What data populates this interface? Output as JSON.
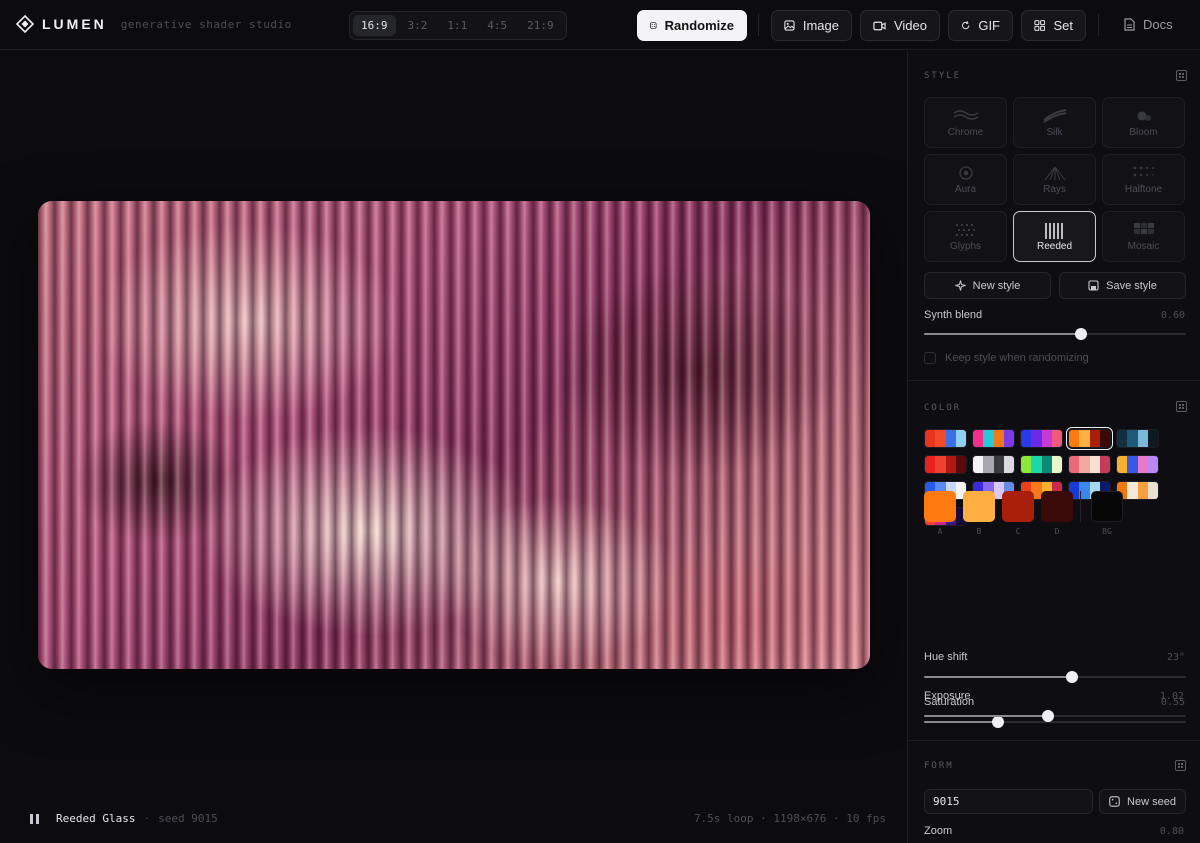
{
  "brand": {
    "name": "LUMEN",
    "subtitle": "generative shader studio"
  },
  "ratios": [
    {
      "label": "16:9",
      "active": true
    },
    {
      "label": "3:2",
      "active": false
    },
    {
      "label": "1:1",
      "active": false
    },
    {
      "label": "4:5",
      "active": false
    },
    {
      "label": "21:9",
      "active": false
    }
  ],
  "toolbar": {
    "randomize_label": "Randomize",
    "image_label": "Image",
    "video_label": "Video",
    "gif_label": "GIF",
    "set_label": "Set",
    "docs_label": "Docs"
  },
  "footer": {
    "title": "Reeded Glass",
    "seed": "seed 9015",
    "stats": "7.5s loop · 1198×676 · 10 fps"
  },
  "style_section": {
    "heading": "STYLE",
    "tiles": [
      {
        "label": "Chrome",
        "icon": "chrome-wave-icon",
        "active": false
      },
      {
        "label": "Silk",
        "icon": "silk-icon",
        "active": false
      },
      {
        "label": "Bloom",
        "icon": "bloom-icon",
        "active": false
      },
      {
        "label": "Aura",
        "icon": "aura-icon",
        "active": false
      },
      {
        "label": "Rays",
        "icon": "rays-icon",
        "active": false
      },
      {
        "label": "Halftone",
        "icon": "halftone-icon",
        "active": false
      },
      {
        "label": "Glyphs",
        "icon": "glyphs-icon",
        "active": false
      },
      {
        "label": "Reeded",
        "icon": "reeded-icon",
        "active": true
      },
      {
        "label": "Mosaic",
        "icon": "mosaic-icon",
        "active": false
      }
    ],
    "new_style_label": "New style",
    "save_style_label": "Save style",
    "synth_blend": {
      "label": "Synth blend",
      "value": "0.60",
      "fraction": 0.6
    },
    "keep_style_label": "Keep style when randomizing",
    "keep_style_checked": false
  },
  "color_section": {
    "heading": "COLOR",
    "palettes": [
      {
        "colors": [
          "#e8351f",
          "#f04a2a",
          "#3b6fe8",
          "#8fd0f0"
        ],
        "selected": false
      },
      {
        "colors": [
          "#f02f8a",
          "#28c8d8",
          "#f07a1a",
          "#7a3ae8"
        ],
        "selected": false
      },
      {
        "colors": [
          "#2a3ae8",
          "#6a2ae8",
          "#c83ad8",
          "#f05a7a"
        ],
        "selected": false
      },
      {
        "colors": [
          "#ff7a10",
          "#ffb040",
          "#a8200a",
          "#3a0a08"
        ],
        "selected": true
      },
      {
        "colors": [
          "#123040",
          "#1d5a78",
          "#7ab8d8",
          "#0c1a24"
        ],
        "selected": false
      },
      {
        "colors": [
          "#e82020",
          "#f04030",
          "#b01818",
          "#5a0a0a"
        ],
        "selected": false
      },
      {
        "colors": [
          "#f4f4f4",
          "#a8a8b0",
          "#3a3a42",
          "#d8d8de"
        ],
        "selected": false
      },
      {
        "colors": [
          "#8ae838",
          "#1ad8a8",
          "#0a8a78",
          "#e8f8c8"
        ],
        "selected": false
      },
      {
        "colors": [
          "#e86a7a",
          "#f0a8a0",
          "#f8e0d0",
          "#c83a5a"
        ],
        "selected": false
      },
      {
        "colors": [
          "#f8b030",
          "#3a58e8",
          "#e878c8",
          "#b888f8"
        ],
        "selected": false
      },
      {
        "colors": [
          "#2a5ae8",
          "#5a8af0",
          "#c8d8f8",
          "#f4f4f8"
        ],
        "selected": false
      },
      {
        "colors": [
          "#3a2ad8",
          "#8a6af0",
          "#d8c8f8",
          "#6a8ae8"
        ],
        "selected": false
      },
      {
        "colors": [
          "#e8401a",
          "#f8781a",
          "#f8b030",
          "#c82a4a"
        ],
        "selected": false
      },
      {
        "colors": [
          "#1a3ad8",
          "#3a88e8",
          "#a8d8f0",
          "#0a1a68"
        ],
        "selected": false
      },
      {
        "colors": [
          "#f07a10",
          "#f8e8d8",
          "#f8a040",
          "#e8e0d0"
        ],
        "selected": false
      },
      {
        "colors": [
          "#f83a3a",
          "#c82a8a",
          "#3a1a88",
          "#180a38"
        ],
        "selected": false
      }
    ],
    "swatches": [
      {
        "label": "A",
        "color": "#ff7a10"
      },
      {
        "label": "B",
        "color": "#ffb040"
      },
      {
        "label": "C",
        "color": "#a8200a"
      },
      {
        "label": "D",
        "color": "#3a0a08"
      }
    ],
    "bg_swatch": {
      "label": "BG",
      "color": "#060606"
    },
    "hue_shift": {
      "label": "Hue shift",
      "value": "23°",
      "fraction": 0.564
    },
    "saturation": {
      "label": "Saturation",
      "value": "0.55",
      "fraction": 0.282
    },
    "exposure": {
      "label": "Exposure",
      "value": "1.02",
      "fraction": 0.473
    }
  },
  "form_section": {
    "heading": "FORM",
    "seed_value": "9015",
    "new_seed_label": "New seed",
    "zoom": {
      "label": "Zoom",
      "value": "0.80"
    }
  }
}
